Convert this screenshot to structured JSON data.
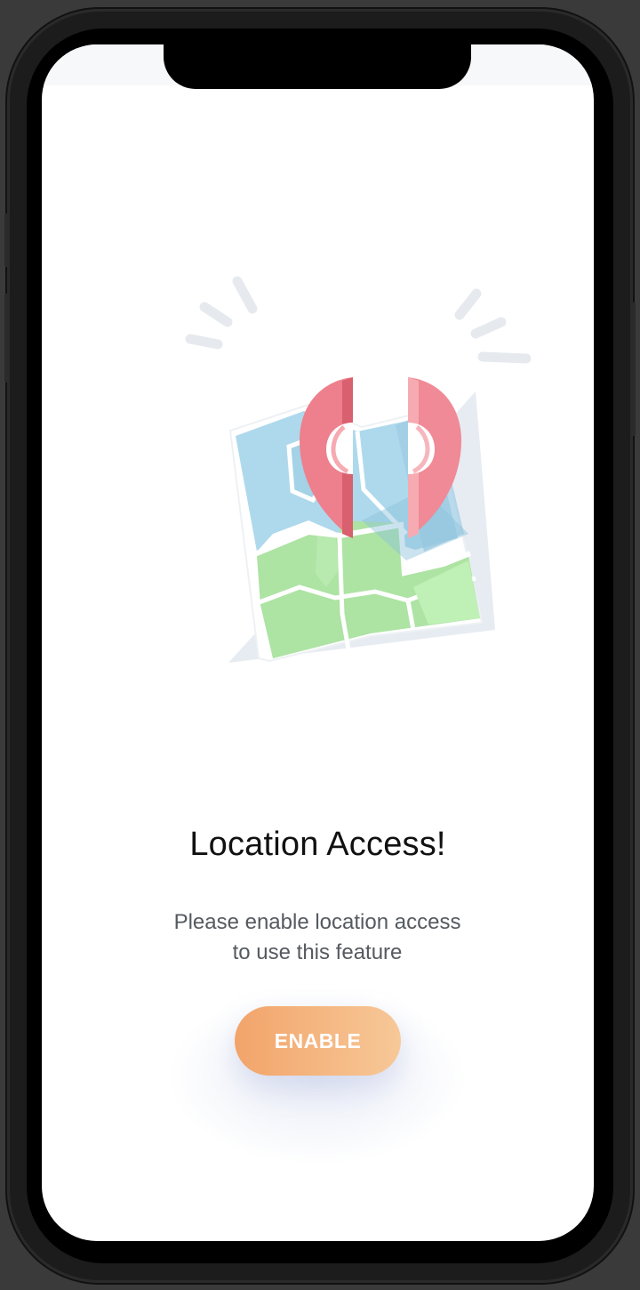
{
  "screen": {
    "title": "Location Access!",
    "message_line1": "Please enable location access",
    "message_line2": "to use this feature",
    "enable_button_label": "ENABLE"
  },
  "illustration": {
    "icon": "map-with-location-pin",
    "colors": {
      "pin": "#ee7f8c",
      "pin_light": "#f6aab2",
      "water": "#aed9ec",
      "land": "#ade3a3",
      "sparkle": "#e6eaee"
    }
  },
  "colors": {
    "button_start": "#f2a46a",
    "button_end": "#f7c898",
    "title": "#111111",
    "message": "#555a60"
  }
}
